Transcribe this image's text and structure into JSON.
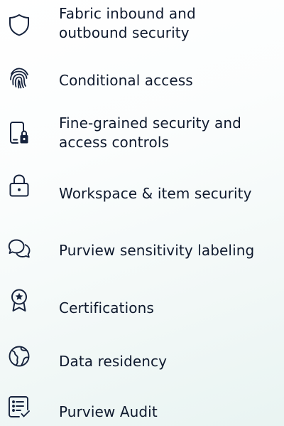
{
  "features": [
    {
      "label": "Fabric inbound and\noutbound security",
      "icon": "shield-icon"
    },
    {
      "label": "Conditional access",
      "icon": "fingerprint-icon"
    },
    {
      "label": "Fine-grained security and\naccess controls",
      "icon": "phone-lock-icon"
    },
    {
      "label": "Workspace & item security",
      "icon": "lock-icon"
    },
    {
      "label": "Purview sensitivity labeling",
      "icon": "chat-bubbles-icon"
    },
    {
      "label": "Certifications",
      "icon": "ribbon-star-icon"
    },
    {
      "label": "Data residency",
      "icon": "globe-icon"
    },
    {
      "label": "Purview Audit",
      "icon": "checklist-icon"
    }
  ],
  "colors": {
    "text": "#0f1a2e",
    "icon": "#16233d",
    "background_tint": "#e9f4f2"
  }
}
